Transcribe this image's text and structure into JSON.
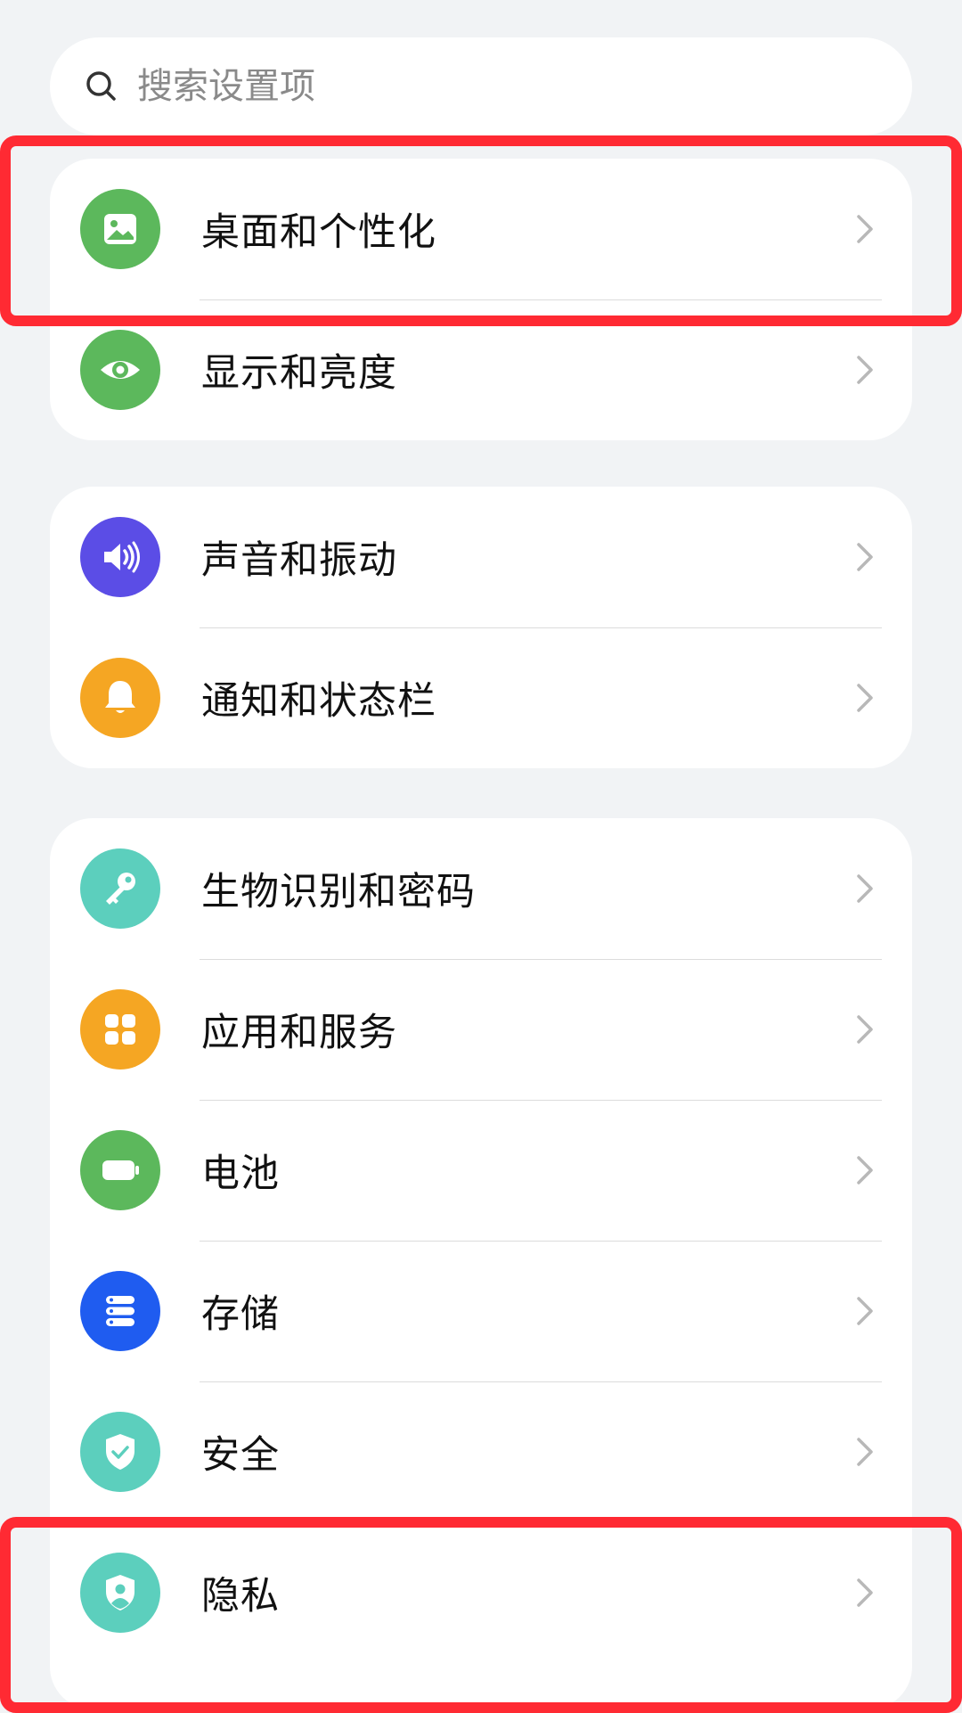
{
  "search": {
    "placeholder": "搜索设置项"
  },
  "groups": [
    {
      "items": [
        {
          "label": "桌面和个性化",
          "icon": "wallpaper-icon",
          "color": "#5cb85c"
        },
        {
          "label": "显示和亮度",
          "icon": "eye-icon",
          "color": "#5cb85c"
        }
      ]
    },
    {
      "items": [
        {
          "label": "声音和振动",
          "icon": "speaker-icon",
          "color": "#5b4de6"
        },
        {
          "label": "通知和状态栏",
          "icon": "bell-icon",
          "color": "#f5a623"
        }
      ]
    },
    {
      "items": [
        {
          "label": "生物识别和密码",
          "icon": "key-icon",
          "color": "#5ccfbd"
        },
        {
          "label": "应用和服务",
          "icon": "apps-grid-icon",
          "color": "#f5a623"
        },
        {
          "label": "电池",
          "icon": "battery-icon",
          "color": "#5cb85c"
        },
        {
          "label": "存储",
          "icon": "storage-icon",
          "color": "#1f5cf0"
        },
        {
          "label": "安全",
          "icon": "shield-check-icon",
          "color": "#5ccfbd"
        },
        {
          "label": "隐私",
          "icon": "privacy-shield-icon",
          "color": "#5ccfbd"
        }
      ]
    }
  ],
  "highlight_color": "#ff2a33"
}
